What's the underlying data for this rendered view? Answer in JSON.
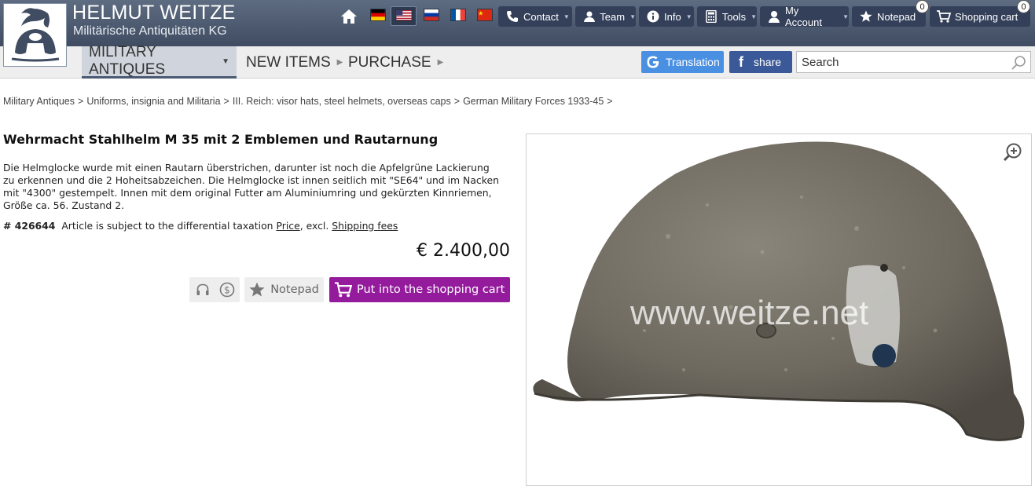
{
  "brand": {
    "title": "HELMUT WEITZE",
    "subtitle": "Militärische Antiquitäten KG"
  },
  "top_nav": {
    "contact": "Contact",
    "team": "Team",
    "info": "Info",
    "tools": "Tools",
    "account": "My Account",
    "notepad": "Notepad",
    "notepad_count": "0",
    "cart": "Shopping cart",
    "cart_count": "0"
  },
  "flags": [
    "german-flag",
    "us-flag",
    "russian-flag",
    "french-flag",
    "chinese-flag"
  ],
  "main_menu": {
    "military": "MILITARY ANTIQUES",
    "new_items": "NEW ITEMS",
    "purchase": "PURCHASE"
  },
  "translation_label": "Translation",
  "share_label": "share",
  "search": {
    "placeholder": "Search"
  },
  "breadcrumb": [
    "Military Antiques",
    "Uniforms, insignia and Militaria",
    "III. Reich: visor hats, steel helmets, overseas caps",
    "German Military Forces 1933-45"
  ],
  "product": {
    "title": "Wehrmacht Stahlhelm M 35 mit 2 Emblemen und Rautarnung",
    "desc_lines": [
      "Die Helmglocke wurde mit einen Rautarn überstrichen, darunter ist noch die Apfelgrüne Lackierung",
      "zu erkennen und die 2 Hoheitsabzeichen. Die Helmglocke ist innen seitlich mit \"SE64\" und im Nacken",
      "mit \"4300\" gestempelt. Innen mit dem original Futter am Aluminiumring und gekürzten Kinnriemen,",
      "Größe ca. 56. Zustand 2."
    ],
    "number": "# 426644",
    "tax_note": "Article is subject to the differential taxation",
    "price_link": "Price",
    "excl": ", excl.",
    "shipping_link": "Shipping fees",
    "price": "€ 2.400,00",
    "notepad_label": "Notepad",
    "cart_label": "Put into the shopping cart",
    "watermark": "www.weitze.net"
  },
  "colors": {
    "header": "#4a566b",
    "cart_button": "#941b9c",
    "translate": "#4a90e2",
    "facebook": "#3b5998"
  }
}
